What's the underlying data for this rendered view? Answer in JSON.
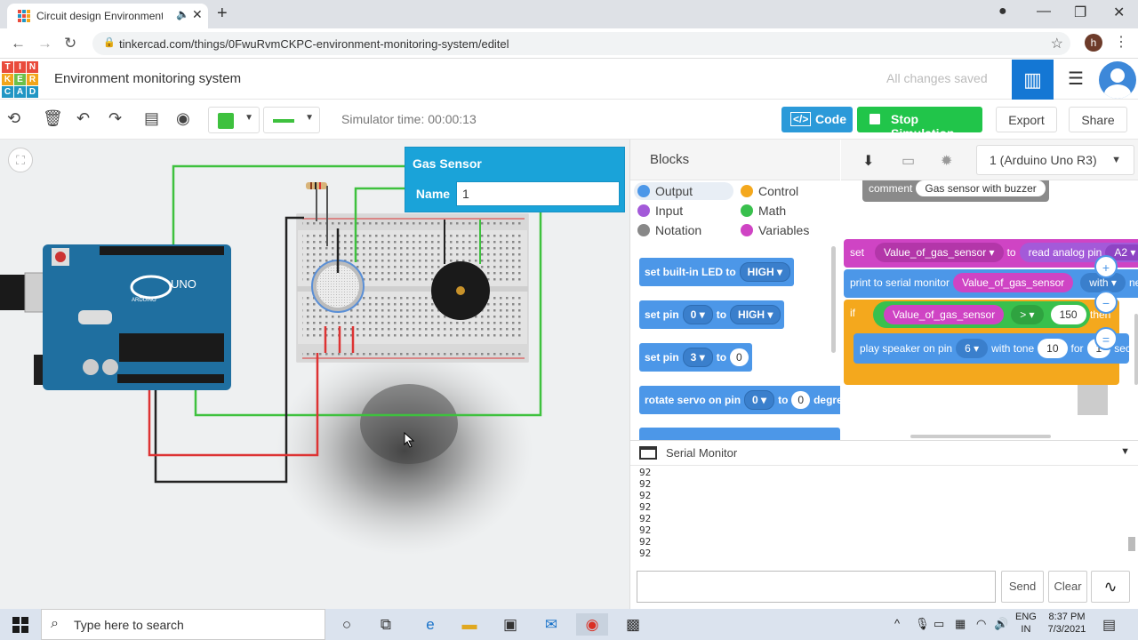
{
  "browser": {
    "tab_title": "Circuit design Environment m",
    "url": "tinkercad.com/things/0FwuRvmCKPC-environment-monitoring-system/editel",
    "profile_initial": "h"
  },
  "app": {
    "logo_letters": [
      "T",
      "I",
      "N",
      "K",
      "E",
      "R",
      "C",
      "A",
      "D"
    ],
    "project_title": "Environment monitoring system",
    "save_status": "All changes saved"
  },
  "toolbar": {
    "sim_time": "Simulator time: 00:00:13",
    "code_label": "Code",
    "stop_label": "Stop Simulation",
    "export_label": "Export",
    "share_label": "Share",
    "wire_color": "#3ec13e"
  },
  "component_popup": {
    "title": "Gas Sensor",
    "name_label": "Name",
    "name_value": "1"
  },
  "board_labels": {
    "uno": "UNO",
    "arduino": "ARDUINO"
  },
  "blocks_panel": {
    "header": "Blocks",
    "categories": [
      {
        "label": "Output",
        "color": "#4c97e8"
      },
      {
        "label": "Control",
        "color": "#f4a81d"
      },
      {
        "label": "Input",
        "color": "#a35ad9"
      },
      {
        "label": "Math",
        "color": "#39c04d"
      },
      {
        "label": "Notation",
        "color": "#888888"
      },
      {
        "label": "Variables",
        "color": "#cf44c4"
      }
    ],
    "blocks": {
      "b1_text": "set built-in LED to",
      "b1_dd": "HIGH",
      "b2_text": "set pin",
      "b2_pin": "0",
      "b2_to": "to",
      "b2_dd": "HIGH",
      "b3_text": "set pin",
      "b3_pin": "3",
      "b3_to": "to",
      "b3_val": "0",
      "b4_text": "rotate servo on pin",
      "b4_pin": "0",
      "b4_to": "to",
      "b4_val": "0",
      "b4_tail": "degre"
    }
  },
  "workspace": {
    "board_select": "1 (Arduino Uno R3)",
    "comment_label": "comment",
    "comment_text": "Gas sensor with buzzer",
    "set_label": "set",
    "var_name": "Value_of_gas_sensor",
    "to_label": "to",
    "read_analog": "read analog pin",
    "analog_pin": "A2",
    "print_label": "print to serial monitor",
    "with_label": "with",
    "newline": "new",
    "if_label": "if",
    "cmp_op": ">",
    "threshold": "150",
    "then_label": "then",
    "play_label": "play speaker on pin",
    "speaker_pin": "6",
    "tone_label": "with tone",
    "tone_val": "10",
    "for_label": "for",
    "for_val": "1",
    "sec_label": "sec"
  },
  "serial": {
    "title": "Serial Monitor",
    "lines": [
      "92",
      "92",
      "92",
      "92",
      "92",
      "92",
      "92",
      "92"
    ],
    "send_label": "Send",
    "clear_label": "Clear"
  },
  "taskbar": {
    "search_placeholder": "Type here to search",
    "lang_1": "ENG",
    "lang_2": "IN",
    "time": "8:37 PM",
    "date": "7/3/2021"
  }
}
